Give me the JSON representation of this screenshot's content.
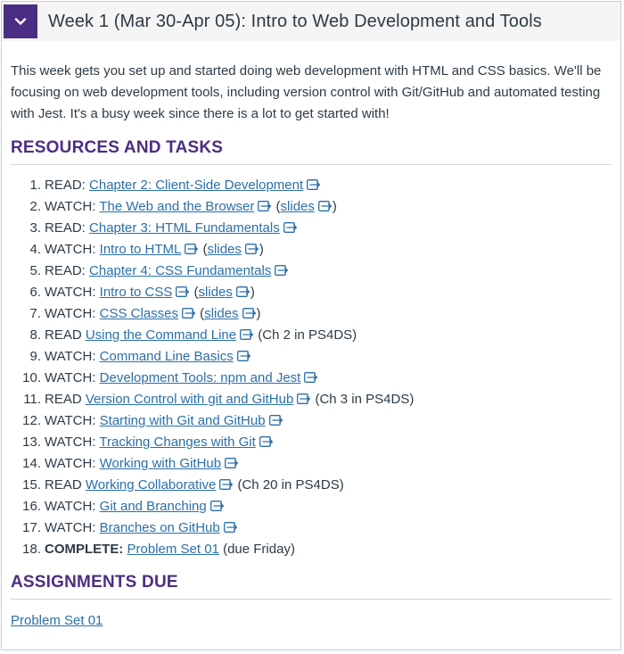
{
  "module": {
    "title": "Week 1 (Mar 30-Apr 05): Intro to Web Development and Tools",
    "intro": "This week gets you set up and started doing web development with HTML and CSS basics. We'll be focusing on web development tools, including version control with Git/GitHub and automated testing with Jest. It's a busy week since there is a lot to get started with!",
    "toggle_icon": "chevron-down-icon",
    "accent_color": "#4b2e83",
    "link_color": "#2b6fa9"
  },
  "resources": {
    "heading": "RESOURCES AND TASKS",
    "items": [
      {
        "num": "1.",
        "prefix": "READ: ",
        "link": "Chapter 2: Client-Side Development",
        "slides": null,
        "suffix": ""
      },
      {
        "num": "2.",
        "prefix": "WATCH: ",
        "link": "The Web and the Browser",
        "slides": "slides",
        "suffix": ""
      },
      {
        "num": "3.",
        "prefix": "READ: ",
        "link": "Chapter 3: HTML Fundamentals",
        "slides": null,
        "suffix": ""
      },
      {
        "num": "4.",
        "prefix": "WATCH: ",
        "link": "Intro to HTML",
        "slides": "slides",
        "suffix": ""
      },
      {
        "num": "5.",
        "prefix": "READ: ",
        "link": "Chapter 4: CSS Fundamentals",
        "slides": null,
        "suffix": ""
      },
      {
        "num": "6.",
        "prefix": "WATCH: ",
        "link": "Intro to CSS",
        "slides": "slides",
        "suffix": ""
      },
      {
        "num": "7.",
        "prefix": "WATCH: ",
        "link": "CSS Classes",
        "slides": "slides",
        "suffix": ""
      },
      {
        "num": "8.",
        "prefix": "READ ",
        "link": "Using the Command Line",
        "slides": null,
        "suffix": " (Ch 2 in PS4DS)"
      },
      {
        "num": "9.",
        "prefix": "WATCH: ",
        "link": "Command Line Basics",
        "slides": null,
        "suffix": ""
      },
      {
        "num": "10.",
        "prefix": "WATCH: ",
        "link": "Development Tools: npm and Jest",
        "slides": null,
        "suffix": ""
      },
      {
        "num": "11.",
        "prefix": "READ ",
        "link": "Version Control with git and GitHub",
        "slides": null,
        "suffix": " (Ch 3 in PS4DS)"
      },
      {
        "num": "12.",
        "prefix": "WATCH: ",
        "link": "Starting with Git and GitHub",
        "slides": null,
        "suffix": ""
      },
      {
        "num": "13.",
        "prefix": "WATCH: ",
        "link": "Tracking Changes with Git",
        "slides": null,
        "suffix": ""
      },
      {
        "num": "14.",
        "prefix": "WATCH: ",
        "link": "Working with GitHub",
        "slides": null,
        "suffix": ""
      },
      {
        "num": "15.",
        "prefix": "READ ",
        "link": "Working Collaborative",
        "slides": null,
        "suffix": " (Ch 20 in PS4DS)"
      },
      {
        "num": "16.",
        "prefix": "WATCH: ",
        "link": "Git and Branching",
        "slides": null,
        "suffix": ""
      },
      {
        "num": "17.",
        "prefix": "WATCH: ",
        "link": "Branches on GitHub",
        "slides": null,
        "suffix": ""
      }
    ],
    "final": {
      "num": "18.",
      "label": "COMPLETE:",
      "link": "Problem Set 01",
      "suffix": " (due Friday)"
    }
  },
  "assignments": {
    "heading": "ASSIGNMENTS DUE",
    "link": "Problem Set 01"
  },
  "icons": {
    "external": "external-link-icon"
  }
}
